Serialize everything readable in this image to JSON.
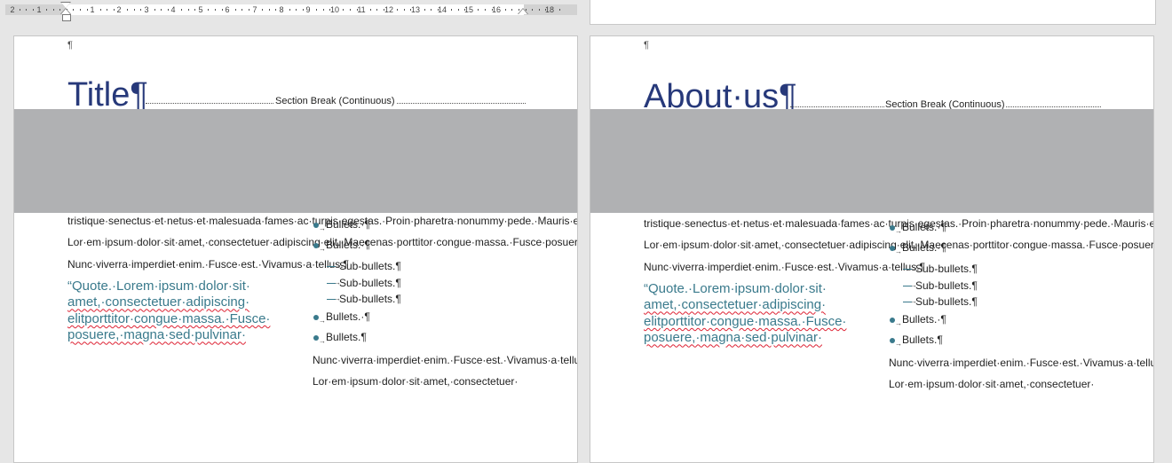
{
  "ruler": {
    "numbers": [
      "2",
      "1",
      "1",
      "2",
      "3",
      "4",
      "5",
      "6",
      "7",
      "8",
      "9",
      "10",
      "11",
      "12",
      "13",
      "14",
      "15",
      "16",
      "18"
    ]
  },
  "pages": [
    {
      "pilcrow": "¶",
      "title": "Title¶",
      "section_break": "Section Break (Continuous)",
      "left_column": {
        "paragraphs": [
          "tristique·senectus·et·netus·et·malesuada·fames·ac·turpis·egestas.·Proin·pharetra·nonummy·pede.·Mauris·et·orci.·Aenean·nec·lorem.·In·porttitor.·Donec·laoreet·nonummy.¶",
          "Lor·em·ipsum·dolor·sit·amet,·consectetuer·adipiscing·elit.·Maecenas·porttitor·congue·massa.·Fusce·posuere,·magna·sed·pulvinar·ultricies,·purus·lectus·malesuada·libero,·sit·amet·commodo·magna·eros·quis·urna.¶",
          "Nunc·viverra·imperdiet·enim.·Fusce·est.·Vivamus·a·tellus.¶"
        ],
        "quote_lines": [
          "“Quote.·Lorem·ipsum·dolor·sit·",
          "amet,·consectetuer·adipiscing·",
          "elitporttitor·congue·massa.·Fusce·",
          "posuere,·magna·sed·pulvinar·"
        ]
      },
      "right_column": {
        "bullets_a": [
          "Bullets.·¶",
          "Bullets.·¶"
        ],
        "sub_bullets": [
          "Sub-bullets.¶",
          "Sub-bullets.¶",
          "Sub-bullets.¶"
        ],
        "bullets_b": [
          "Bullets.·¶",
          "Bullets.¶"
        ],
        "paragraphs": [
          "Nunc·viverra·imperdiet·enim.·Fusce·est.·Vivamus·a·tellus.·Pellentesque·habitant·morbi·tristique·senectus·et·netus·et·malesuada·fames·ac·turpis·egestas.·Proin·pharetra·nonummy·pede.·Mauris·et·orci.·Aenean·nec·lorem.·In·porttitor.·Donec·laoreet·nonummy.¶",
          "Lor·em·ipsum·dolor·sit·amet,·consectetuer·"
        ]
      }
    },
    {
      "pilcrow": "¶",
      "title": "About·us¶",
      "section_break": "Section Break (Continuous)",
      "left_column": {
        "paragraphs": [
          "tristique·senectus·et·netus·et·malesuada·fames·ac·turpis·egestas.·Proin·pharetra·nonummy·pede.·Mauris·et·orci.·Aenean·nec·lorem.·In·porttitor.·Donec·laoreet·nonummy.¶",
          "Lor·em·ipsum·dolor·sit·amet,·consectetuer·adipiscing·elit.·Maecenas·porttitor·congue·massa.·Fusce·posuere,·magna·sed·pulvinar·ultricies,·purus·lectus·malesuada·libero,·sit·amet·commodo·magna·eros·quis·urna.¶",
          "Nunc·viverra·imperdiet·enim.·Fusce·est.·Vivamus·a·tellus.¶"
        ],
        "quote_lines": [
          "“Quote.·Lorem·ipsum·dolor·sit·",
          "amet,·consectetuer·adipiscing·",
          "elitporttitor·congue·massa.·Fusce·",
          "posuere,·magna·sed·pulvinar·"
        ]
      },
      "right_column": {
        "bullets_a": [
          "Bullets.·¶",
          "Bullets.·¶"
        ],
        "sub_bullets": [
          "Sub-bullets.¶",
          "Sub-bullets.¶",
          "Sub-bullets.¶"
        ],
        "bullets_b": [
          "Bullets.·¶",
          "Bullets.¶"
        ],
        "paragraphs": [
          "Nunc·viverra·imperdiet·enim.·Fusce·est.·Vivamus·a·tellus.·Pellentesque·habitant·morbi·tristique·senectus·et·netus·et·malesuada·fames·ac·turpis·egestas.·Proin·pharetra·nonummy·pede.·Mauris·et·orci.·Aenean·nec·lorem.·In·porttitor.·Donec·laoreet·nonummy.¶",
          "Lor·em·ipsum·dolor·sit·amet,·consectetuer·"
        ]
      }
    }
  ],
  "colors": {
    "title": "#27397a",
    "quote": "#3a7a8c",
    "banner": "#b0b1b3",
    "bullet": "#3a7a8c"
  }
}
